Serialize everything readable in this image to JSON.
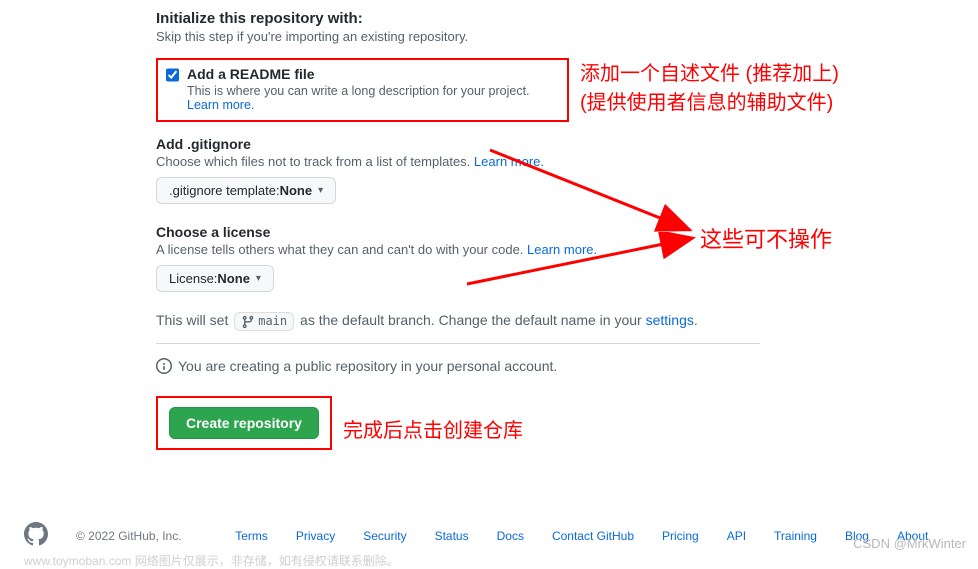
{
  "init": {
    "title": "Initialize this repository with:",
    "subtitle": "Skip this step if you're importing an existing repository."
  },
  "readme": {
    "checked": true,
    "label": "Add a README file",
    "desc": "This is where you can write a long description for your project. ",
    "learn": "Learn more."
  },
  "gitignore": {
    "title": "Add .gitignore",
    "desc": "Choose which files not to track from a list of templates. ",
    "learn": "Learn more.",
    "dd_prefix": ".gitignore template: ",
    "dd_value": "None"
  },
  "license": {
    "title": "Choose a license",
    "desc": "A license tells others what they can and can't do with your code. ",
    "learn": "Learn more.",
    "dd_prefix": "License: ",
    "dd_value": "None"
  },
  "branch": {
    "prefix": "This will set ",
    "name": "main",
    "middle": " as the default branch. Change the default name in your ",
    "settings": "settings",
    "dot": "."
  },
  "info_text": "You are creating a public repository in your personal account.",
  "create_btn": "Create repository",
  "annot": {
    "readme_line1": "添加一个自述文件 (推荐加上)",
    "readme_line2": "(提供使用者信息的辅助文件)",
    "optional": "这些可不操作",
    "create": "完成后点击创建仓库"
  },
  "footer": {
    "copy": "© 2022 GitHub, Inc.",
    "links": [
      "Terms",
      "Privacy",
      "Security",
      "Status",
      "Docs",
      "Contact GitHub",
      "Pricing",
      "API",
      "Training",
      "Blog",
      "About"
    ]
  },
  "watermark_csdn": "CSDN @MrkWinter",
  "watermark_bottom": "www.toymoban.com  网络图片仅展示，非存储，如有侵权请联系删除。"
}
